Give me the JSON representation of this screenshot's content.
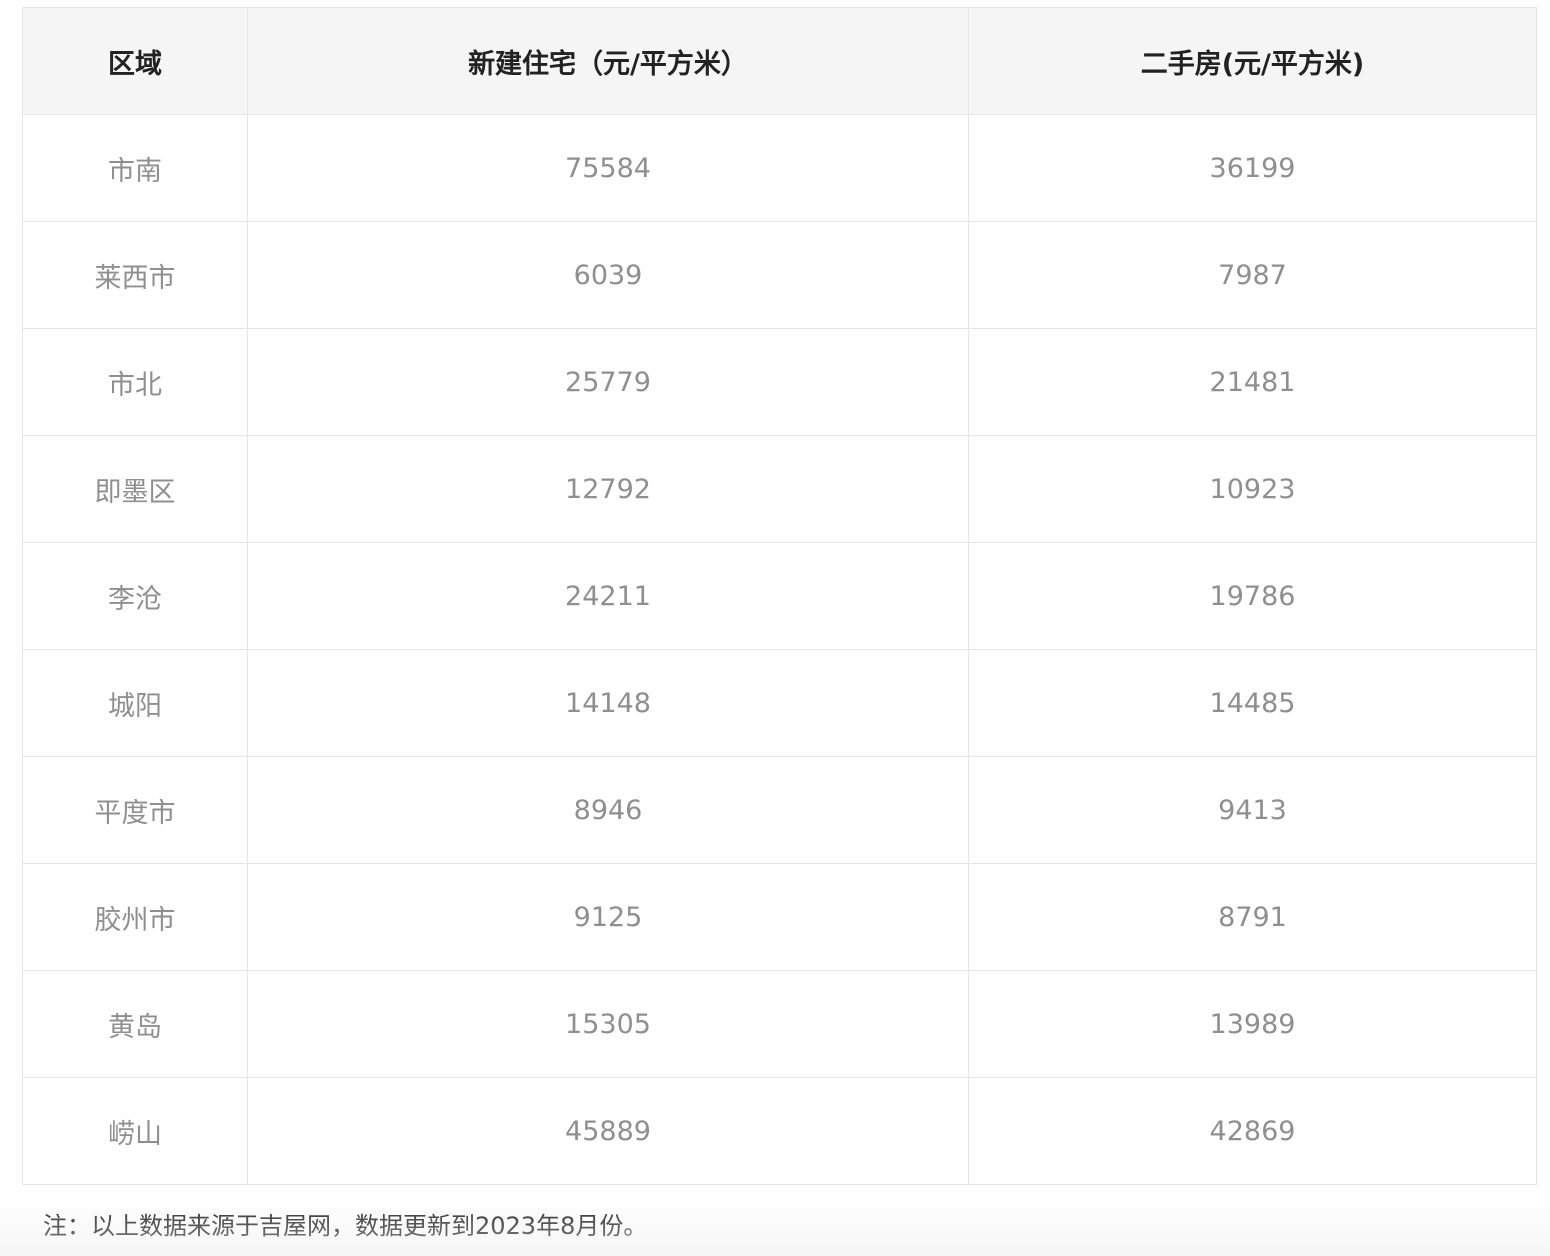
{
  "table": {
    "headers": [
      "区域",
      "新建住宅（元/平方米）",
      "二手房(元/平方米)"
    ],
    "rows": [
      [
        "市南",
        "75584",
        "36199"
      ],
      [
        "莱西市",
        "6039",
        "7987"
      ],
      [
        "市北",
        "25779",
        "21481"
      ],
      [
        "即墨区",
        "12792",
        "10923"
      ],
      [
        "李沧",
        "24211",
        "19786"
      ],
      [
        "城阳",
        "14148",
        "14485"
      ],
      [
        "平度市",
        "8946",
        "9413"
      ],
      [
        "胶州市",
        "9125",
        "8791"
      ],
      [
        "黄岛",
        "15305",
        "13989"
      ],
      [
        "崂山",
        "45889",
        "42869"
      ]
    ]
  },
  "note": "注：以上数据来源于吉屋网，数据更新到2023年8月份。",
  "colors": {
    "header_bg": "#f5f5f5",
    "header_text": "#222222",
    "cell_text": "#8f8f8f",
    "border": "#e6e6e6"
  }
}
